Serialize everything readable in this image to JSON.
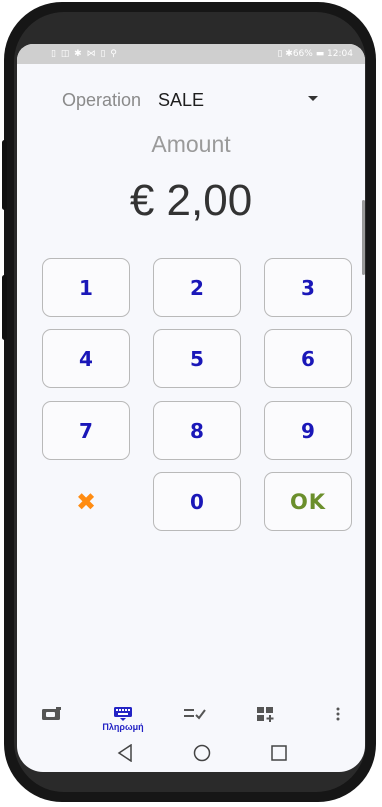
{
  "status_bar": {
    "left_icons": "▯ ◫ ✱ ⋈ ▯ ⚲",
    "right_text": "▯ ✱66% ▬ 12:04"
  },
  "operation": {
    "label": "Operation",
    "value": "SALE"
  },
  "amount": {
    "label": "Amount",
    "value": "€ 2,00"
  },
  "keypad": {
    "keys": [
      "1",
      "2",
      "3",
      "4",
      "5",
      "6",
      "7",
      "8",
      "9"
    ],
    "cancel": "✖",
    "zero": "0",
    "ok": "OK"
  },
  "bottom_nav": {
    "items": [
      {
        "icon": "wallet-icon",
        "label": ""
      },
      {
        "icon": "keypad-icon",
        "label": "Πληρωμή"
      },
      {
        "icon": "list-check-icon",
        "label": ""
      },
      {
        "icon": "grid-add-icon",
        "label": ""
      },
      {
        "icon": "more-vert-icon",
        "label": ""
      }
    ]
  },
  "colors": {
    "key_text": "#1a17b8",
    "ok_text": "#6b8f2c",
    "cancel": "#ff8c12",
    "nav_active": "#2323c5"
  }
}
